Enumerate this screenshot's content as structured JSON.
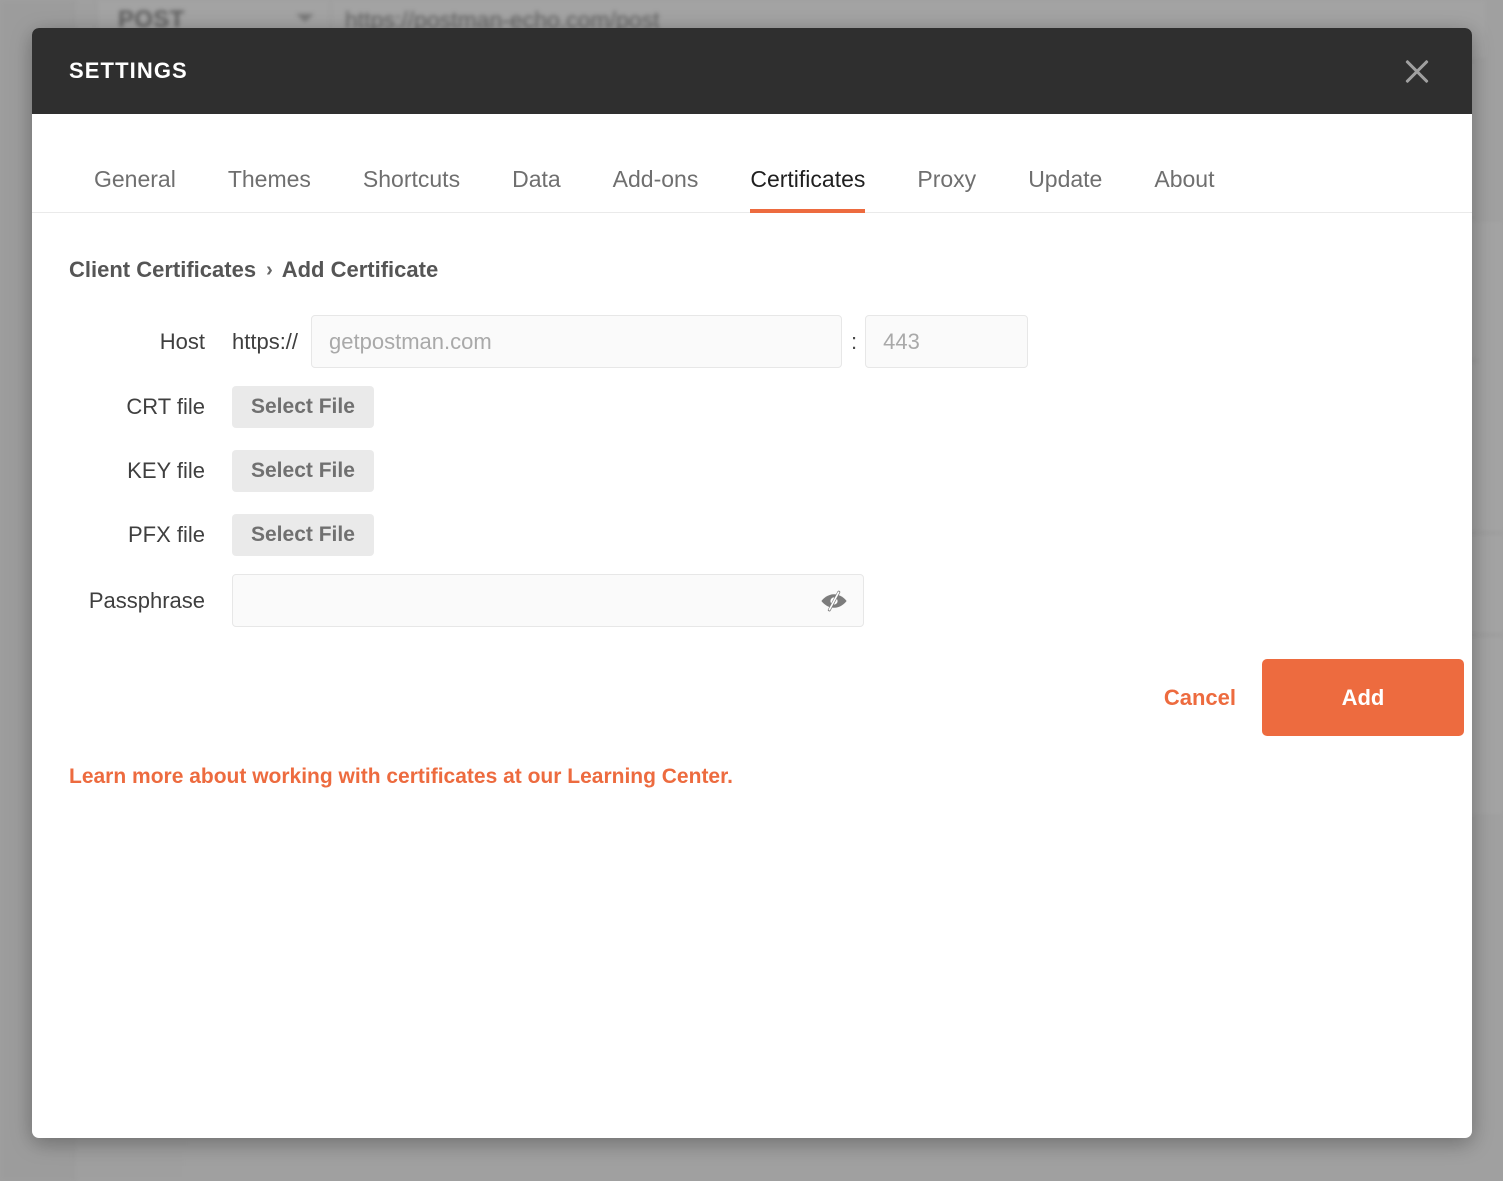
{
  "backdrop": {
    "method": "POST",
    "url": "https://postman-echo.com/post"
  },
  "modal": {
    "title": "SETTINGS",
    "close_icon": "close-icon",
    "tabs": [
      {
        "label": "General",
        "active": false
      },
      {
        "label": "Themes",
        "active": false
      },
      {
        "label": "Shortcuts",
        "active": false
      },
      {
        "label": "Data",
        "active": false
      },
      {
        "label": "Add-ons",
        "active": false
      },
      {
        "label": "Certificates",
        "active": true
      },
      {
        "label": "Proxy",
        "active": false
      },
      {
        "label": "Update",
        "active": false
      },
      {
        "label": "About",
        "active": false
      }
    ],
    "breadcrumb": {
      "root": "Client Certificates",
      "separator": "›",
      "current": "Add Certificate"
    },
    "form": {
      "host": {
        "label": "Host",
        "scheme": "https://",
        "value": "",
        "placeholder": "getpostman.com",
        "colon": ":",
        "port_value": "",
        "port_placeholder": "443"
      },
      "crt": {
        "label": "CRT file",
        "button": "Select File"
      },
      "key": {
        "label": "KEY file",
        "button": "Select File"
      },
      "pfx": {
        "label": "PFX file",
        "button": "Select File"
      },
      "passphrase": {
        "label": "Passphrase",
        "value": "",
        "placeholder": "",
        "toggle_icon": "eye-off-icon"
      }
    },
    "actions": {
      "cancel": "Cancel",
      "add": "Add"
    },
    "learn_more": "Learn more about working with certificates at our Learning Center."
  },
  "colors": {
    "accent": "#ed6b3f",
    "header_bg": "#2f2f2f",
    "overlay": "#6c6c6c",
    "button_gray": "#eaeaea"
  }
}
